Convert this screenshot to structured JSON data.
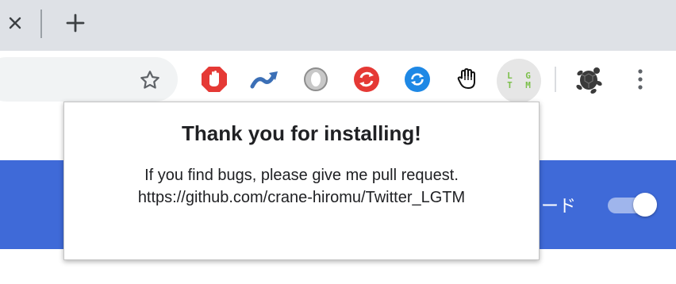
{
  "browser": {
    "tab_strip": {
      "close_tab_label": "×",
      "new_tab_label": "+"
    },
    "toolbar": {
      "bookmark_icon": "star-outline-icon",
      "extensions": [
        {
          "name": "adblock",
          "icon": "red-octagon-hand-icon",
          "color": "#e53935"
        },
        {
          "name": "wave-arrow",
          "icon": "blue-wave-arrow-icon",
          "color": "#3b6fb6"
        },
        {
          "name": "gray-ring",
          "icon": "gray-ring-icon",
          "color": "#9e9e9e"
        },
        {
          "name": "red-refresh",
          "icon": "red-refresh-icon",
          "color": "#e53935"
        },
        {
          "name": "blue-sync",
          "icon": "blue-sync-icon",
          "color": "#1e88e5"
        },
        {
          "name": "hand-cursor",
          "icon": "glove-hand-icon",
          "color": "#111111"
        },
        {
          "name": "lgtm",
          "icon": "lgtm-icon",
          "label": "L G\nT M",
          "color": "#7cc04b"
        },
        {
          "name": "turtle",
          "icon": "turtle-icon",
          "color": "#3a3a3a"
        }
      ],
      "menu_icon": "kebab-menu-icon"
    }
  },
  "page": {
    "toggle_label": "ード",
    "toggle_on": true,
    "accent_color": "#3f6ad8"
  },
  "popup": {
    "title": "Thank you for installing!",
    "line1": "If you find bugs, please give me pull request.",
    "line2": "https://github.com/crane-hiromu/Twitter_LGTM"
  }
}
